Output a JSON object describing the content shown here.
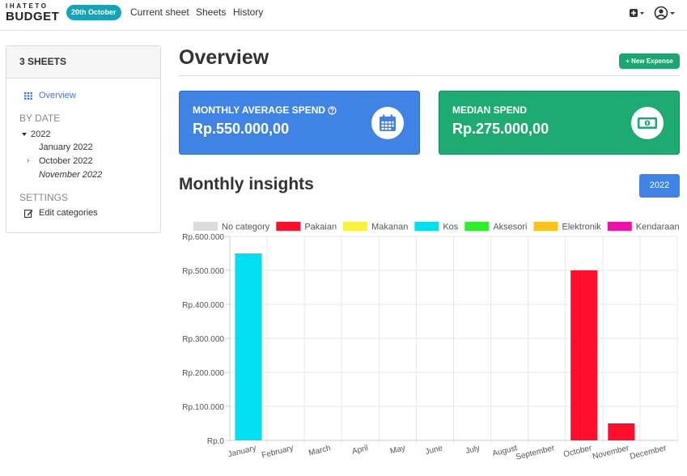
{
  "nav": {
    "logo_top": "IHATETO",
    "logo_bottom": "BUDGET",
    "date_badge": "20th October",
    "links": [
      "Current sheet",
      "Sheets",
      "History"
    ]
  },
  "sidebar": {
    "header": "3 SHEETS",
    "overview_label": "Overview",
    "by_date_label": "BY DATE",
    "year": "2022",
    "months": [
      "January 2022",
      "October 2022",
      "November 2022"
    ],
    "settings_label": "SETTINGS",
    "edit_categories_label": "Edit categories"
  },
  "main": {
    "title": "Overview",
    "new_expense_label": "New Expense",
    "cards": {
      "average": {
        "label": "MONTHLY AVERAGE SPEND",
        "value": "Rp.550.000,00",
        "icon": "calendar-icon",
        "color": "#3f84e5"
      },
      "median": {
        "label": "MEDIAN SPEND",
        "value": "Rp.275.000,00",
        "icon": "money-icon",
        "color": "#1eab72"
      }
    },
    "insights_title": "Monthly insights",
    "year_button": "2022"
  },
  "chart_data": {
    "type": "bar",
    "categories": [
      "January",
      "February",
      "March",
      "April",
      "May",
      "June",
      "July",
      "August",
      "September",
      "October",
      "November",
      "December"
    ],
    "series": [
      {
        "name": "No category",
        "color": "#dcdcdc",
        "values": [
          0,
          0,
          0,
          0,
          0,
          0,
          0,
          0,
          0,
          0,
          0,
          0
        ]
      },
      {
        "name": "Pakaian",
        "color": "#ff0d2a",
        "values": [
          0,
          0,
          0,
          0,
          0,
          0,
          0,
          0,
          0,
          500000,
          50000,
          0
        ]
      },
      {
        "name": "Makanan",
        "color": "#f8f23a",
        "values": [
          0,
          0,
          0,
          0,
          0,
          0,
          0,
          0,
          0,
          0,
          0,
          0
        ]
      },
      {
        "name": "Kos",
        "color": "#00e0f0",
        "values": [
          550000,
          0,
          0,
          0,
          0,
          0,
          0,
          0,
          0,
          0,
          0,
          0
        ]
      },
      {
        "name": "Aksesori",
        "color": "#2df02a",
        "values": [
          0,
          0,
          0,
          0,
          0,
          0,
          0,
          0,
          0,
          0,
          0,
          0
        ]
      },
      {
        "name": "Elektronik",
        "color": "#ffc21a",
        "values": [
          0,
          0,
          0,
          0,
          0,
          0,
          0,
          0,
          0,
          0,
          0,
          0
        ]
      },
      {
        "name": "Kendaraan",
        "color": "#ee10a8",
        "values": [
          0,
          0,
          0,
          0,
          0,
          0,
          0,
          0,
          0,
          0,
          0,
          0
        ]
      }
    ],
    "ylim": [
      0,
      600000
    ],
    "y_ticks": [
      "Rp.0",
      "Rp.100.000",
      "Rp.200.000",
      "Rp.300.000",
      "Rp.400.000",
      "Rp.500.000",
      "Rp.600.000"
    ],
    "legend_position": "top",
    "grid": true
  }
}
